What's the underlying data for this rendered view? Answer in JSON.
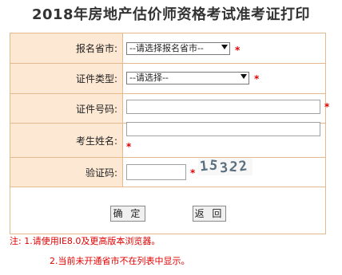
{
  "page": {
    "title": "2018年房地产估价师资格考试准考证打印"
  },
  "form": {
    "province": {
      "label": "报名省市:",
      "value": "--请选择报名省市--"
    },
    "id_type": {
      "label": "证件类型:",
      "value": "--请选择--"
    },
    "id_number": {
      "label": "证件号码:",
      "value": ""
    },
    "name": {
      "label": "考生姓名:",
      "value": ""
    },
    "captcha": {
      "label": "验证码:",
      "value": "",
      "image_text": [
        "1",
        "5",
        "3",
        "2",
        "2"
      ]
    },
    "required_mark": "*"
  },
  "buttons": {
    "confirm": "确 定",
    "back": "返 回"
  },
  "notes": {
    "line1": "注: 1.请使用IE8.0及更高版本浏览器。",
    "line2": "2.当前未开通省市不在列表中显示。"
  }
}
